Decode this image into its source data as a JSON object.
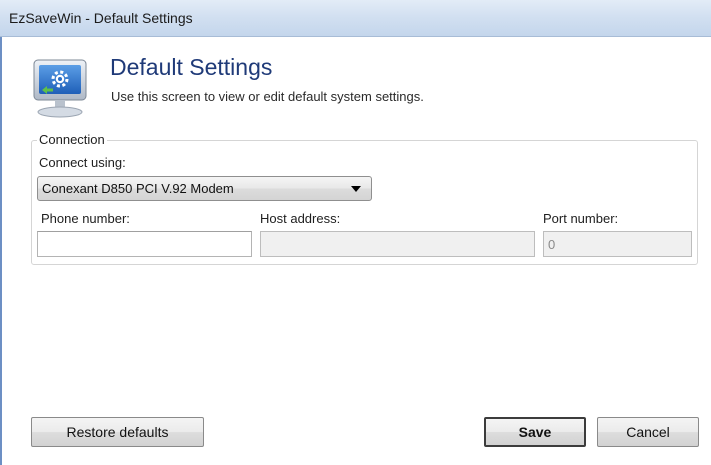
{
  "window": {
    "title": "EzSaveWin - Default Settings"
  },
  "header": {
    "icon": "settings-monitor-icon",
    "title": "Default Settings",
    "description": "Use this screen to view or edit default system settings."
  },
  "connection": {
    "group_label": "Connection",
    "connect_using_label": "Connect using:",
    "connect_using_value": "Conexant D850 PCI V.92 Modem",
    "phone_number_label": "Phone number:",
    "phone_number_value": "",
    "host_address_label": "Host address:",
    "host_address_value": "",
    "port_number_label": "Port number:",
    "port_number_value": "0"
  },
  "buttons": {
    "restore_defaults": "Restore defaults",
    "save": "Save",
    "cancel": "Cancel"
  },
  "colors": {
    "title_accent": "#1f3a78",
    "titlebar": "#d2e0f1"
  }
}
